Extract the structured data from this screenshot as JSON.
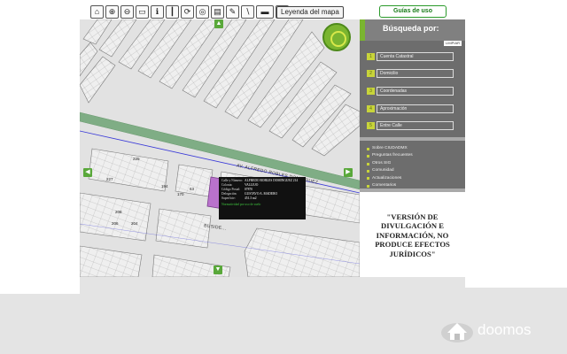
{
  "toolbar": {
    "tools": [
      "home-icon",
      "zoom-in-icon",
      "zoom-out-icon",
      "pan-icon",
      "info-icon",
      "measure-icon",
      "rotate-icon",
      "select-icon",
      "layers-icon",
      "clear-icon",
      "print-icon",
      "view-icon"
    ],
    "legend_label": "Leyenda del mapa",
    "guides_label": "Guías de uso"
  },
  "map": {
    "street_label": "AV. ALFREDO ROBLES DOMINGUEZ",
    "street_label_2": "BUSIDE...",
    "lot_numbers": [
      "227",
      "225",
      "208",
      "206",
      "204",
      "194",
      "170",
      "63",
      "216",
      "64"
    ],
    "colors": {
      "road": "#7fad85",
      "highlight_lot": "#b972cc",
      "blocks": "#eeeeee"
    }
  },
  "popup": {
    "rows": [
      {
        "k": "Calle y Número:",
        "v": "ALFREDO ROBLES DOMINGUEZ 214"
      },
      {
        "k": "Colonia:",
        "v": "VALLEJO"
      },
      {
        "k": "Código Postal:",
        "v": "07870"
      },
      {
        "k": "Delegación:",
        "v": "GUSTAVO A. MADERO"
      },
      {
        "k": "Superficie:",
        "v": "451.3 m2"
      }
    ],
    "link": "Normatividad por uso de suelo"
  },
  "panel": {
    "title": "Búsqueda por:",
    "clear_label": "LIMPIAR",
    "options": [
      {
        "n": "1",
        "label": "Cuenta Catastral"
      },
      {
        "n": "2",
        "label": "Domicilio"
      },
      {
        "n": "3",
        "label": "Coordenadas"
      },
      {
        "n": "4",
        "label": "Aproximación"
      },
      {
        "n": "5",
        "label": "Entre Calle"
      }
    ],
    "links": [
      "Sobre CIUDADMX",
      "Preguntas frecuentes",
      "Otros SIG",
      "Comunidad",
      "Actualizaciones",
      "Comentarios"
    ],
    "disclaimer": "\"VERSIÓN DE DIVULGACIÓN E INFORMACIÓN, NO PRODUCE EFECTOS JURÍDICOS\""
  },
  "watermark": {
    "text": "doomos"
  }
}
